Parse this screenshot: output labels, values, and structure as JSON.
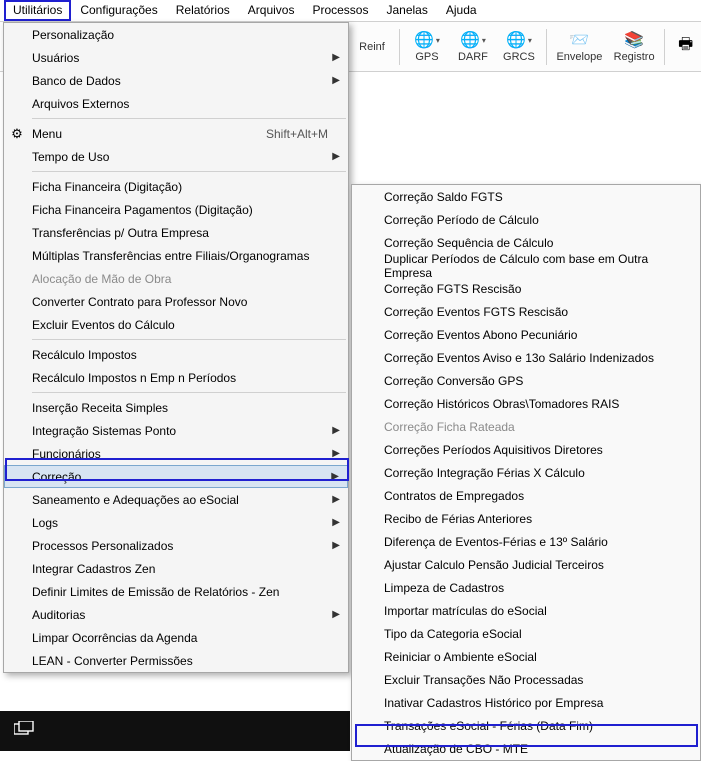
{
  "menubar": {
    "items": [
      "Utilitários",
      "Configurações",
      "Relatórios",
      "Arquivos",
      "Processos",
      "Janelas",
      "Ajuda"
    ]
  },
  "toolbar": {
    "reinf_label": "Reinf",
    "gps_label": "GPS",
    "darf_label": "DARF",
    "grcs_label": "GRCS",
    "envelope_label": "Envelope",
    "registro_label": "Registro"
  },
  "main_menu": {
    "personalizacao": "Personalização",
    "usuarios": "Usuários",
    "banco_dados": "Banco de Dados",
    "arquivos_externos": "Arquivos Externos",
    "menu": "Menu",
    "menu_shortcut": "Shift+Alt+M",
    "tempo_uso": "Tempo de Uso",
    "ficha_fin_dig": "Ficha Financeira (Digitação)",
    "ficha_fin_pag": "Ficha Financeira Pagamentos (Digitação)",
    "transferencias": "Transferências p/ Outra Empresa",
    "multiplas_transf": "Múltiplas Transferências entre Filiais/Organogramas",
    "alocacao": "Alocação de Mão de Obra",
    "converter_contrato": "Converter Contrato para Professor Novo",
    "excluir_eventos": "Excluir Eventos do Cálculo",
    "recalculo_impostos": "Recálculo Impostos",
    "recalculo_n": "Recálculo Impostos n Emp n Períodos",
    "insercao_receita": "Inserção Receita Simples",
    "integracao_sistemas": "Integração Sistemas Ponto",
    "funcionarios": "Funcionários",
    "correcao": "Correção",
    "saneamento": "Saneamento e Adequações ao eSocial",
    "logs": "Logs",
    "processos_pers": "Processos Personalizados",
    "integrar_zen": "Integrar Cadastros Zen",
    "definir_limites": "Definir Limites de Emissão de Relatórios - Zen",
    "auditorias": "Auditorias",
    "limpar_ocorrencias": "Limpar Ocorrências da Agenda",
    "lean_converter": "LEAN - Converter Permissões"
  },
  "sub_menu": {
    "items": [
      "Correção Saldo FGTS",
      "Correção Período de Cálculo",
      "Correção Sequência de Cálculo",
      "Duplicar Períodos de Cálculo com base em Outra Empresa",
      "Correção FGTS Rescisão",
      "Correção Eventos FGTS Rescisão",
      "Correção Eventos Abono Pecuniário",
      "Correção Eventos Aviso e 13o Salário Indenizados",
      "Correção Conversão GPS",
      "Correção Históricos Obras\\Tomadores RAIS",
      "Correção Ficha Rateada",
      "Correções Períodos Aquisitivos Diretores",
      "Correção Integração Férias X Cálculo",
      "Contratos de Empregados",
      "Recibo de Férias Anteriores",
      "Diferença de Eventos-Férias e 13º Salário",
      "Ajustar Calculo Pensão Judicial Terceiros",
      "Limpeza de Cadastros",
      "Importar matrículas do eSocial",
      "Tipo da Categoria eSocial",
      "Reiniciar o Ambiente eSocial",
      "Excluir Transações Não Processadas",
      "Inativar Cadastros Histórico por Empresa",
      "Transações eSocial - Férias (Data Fim)",
      "Atualização de CBO - MTE"
    ],
    "disabled_index": 10
  }
}
